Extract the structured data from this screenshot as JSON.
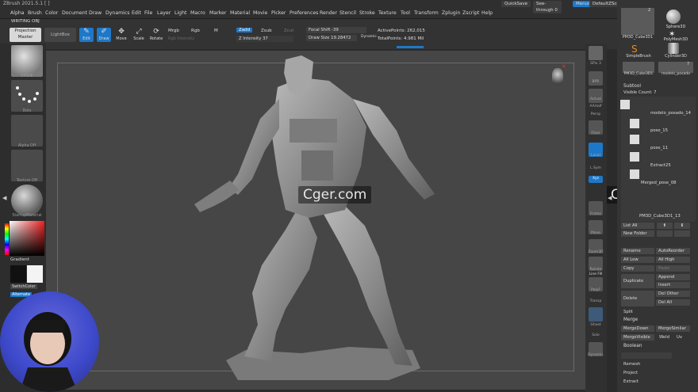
{
  "app": {
    "title": "ZBrush 2021.5.1 [ ]"
  },
  "menu": [
    "Alpha",
    "Brush",
    "Color",
    "Document",
    "Draw",
    "Dynamics",
    "Edit",
    "File",
    "Layer",
    "Light",
    "Macro",
    "Marker",
    "Material",
    "Movie",
    "Picker",
    "Preferences",
    "Render",
    "Stencil",
    "Stroke",
    "Texture",
    "Tool",
    "Transform",
    "Zplugin",
    "Zscript",
    "Help"
  ],
  "topright": {
    "quicksave": "QuickSave",
    "seethrough": "See-through",
    "seethrough_value": "0",
    "menus": "Menus",
    "script": "DefaultZScript"
  },
  "doc_label": "WRITING OBJ",
  "toolbar": {
    "projection_master": "Projection Master",
    "lightbox": "LightBox",
    "tools": [
      "Edit",
      "Draw",
      "Move",
      "Scale",
      "Rotate"
    ],
    "mrgb": "Mrgb",
    "rgb": "Rgb",
    "m": "M",
    "rgb_intensity": "Rgb Intensity",
    "zadd": "Zadd",
    "zsub": "Zsub",
    "zcut": "Zcut",
    "z_intensity_label": "Z Intensity",
    "z_intensity_value": "37",
    "focal_shift_label": "Focal Shift",
    "focal_shift_value": "-39",
    "draw_size_label": "Draw Size",
    "draw_size_value": "19.28472",
    "dynamic": "Dynamic",
    "active_points": "ActivePoints: 262,015",
    "total_points": "TotalPoints: 4.981 Mil"
  },
  "left_panel": {
    "items": [
      "InflatE",
      "Dots",
      "Alpha Off",
      "Texture Off",
      "StartupMaterial"
    ],
    "gradient": "Gradient",
    "switch_color": "SwitchColor",
    "alternate": "Alternate"
  },
  "right_tools": [
    "SPix 3",
    "BPR",
    "Actual",
    "AAHalf",
    "Persp",
    "Floor",
    "Local",
    "L.Sym",
    "Xyz",
    "Frame",
    "Move",
    "Zoom3D",
    "Rotate",
    "Line Fill",
    "PolyF",
    "Transp",
    "Ghost",
    "Solo",
    "Dynamic"
  ],
  "tool_palette": {
    "thumbs": [
      "PM3D_Cube3D1",
      "Sphere3D",
      "PolyMesh3D",
      "SimpleBrush",
      "Cylinder3D",
      "PM3D_Cube3D1",
      "modelo_posado"
    ],
    "thumb_counts": [
      "2",
      "7"
    ]
  },
  "subtool": {
    "title": "Subtool",
    "visible_count": "Visible Count: 7",
    "items": [
      "modelo_posado_14",
      "pose_15",
      "pose_11",
      "Extract25",
      "Merged_pose_08",
      "PM3D_Cube3D1_13"
    ],
    "list_all": "List All",
    "new_folder": "New Folder",
    "rename": "Rename",
    "autoreorder": "AutoReorder",
    "all_low": "All Low",
    "all_high": "All High",
    "copy": "Copy",
    "paste": "Paste",
    "duplicate": "Duplicate",
    "append": "Append",
    "insert": "Insert",
    "delete": "Delete",
    "del_other": "Del Other",
    "del_all": "Del All",
    "split": "Split",
    "merge": "Merge",
    "merge_down": "MergeDown",
    "merge_similar": "MergeSimilar",
    "merge_visible": "MergeVisible",
    "weld": "Weld",
    "uv": "Uv",
    "boolean": "Boolean",
    "remesh": "Remesh",
    "project": "Project",
    "extract": "Extract"
  },
  "watermark": "Cger.com",
  "colors": {
    "accent": "#1e78c8",
    "panel": "#343434",
    "viewport": "#464646"
  }
}
